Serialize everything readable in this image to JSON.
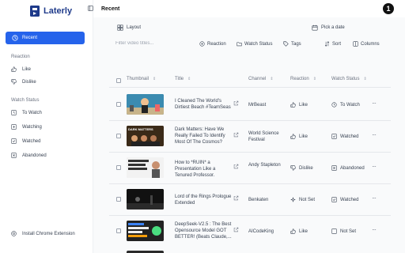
{
  "app": {
    "name": "Laterly"
  },
  "sidebar": {
    "recent_label": "Recent",
    "reaction_heading": "Reaction",
    "reaction_items": [
      {
        "label": "Like",
        "icon": "thumbs-up-icon"
      },
      {
        "label": "Dislike",
        "icon": "thumbs-down-icon"
      }
    ],
    "watch_heading": "Watch Status",
    "watch_items": [
      {
        "label": "To Watch",
        "icon": "clock-icon"
      },
      {
        "label": "Watching",
        "icon": "play-icon"
      },
      {
        "label": "Watched",
        "icon": "check-square-icon"
      },
      {
        "label": "Abandoned",
        "icon": "x-square-icon"
      }
    ],
    "install_label": "Install Chrome Extension"
  },
  "header": {
    "title": "Recent",
    "badge": "1"
  },
  "toolbar": {
    "layout_label": "Layout",
    "date_label": "Pick a date",
    "filter_placeholder": "Filter video titles...",
    "reaction_label": "Reaction",
    "watch_status_label": "Watch Status",
    "tags_label": "Tags",
    "sort_label": "Sort",
    "columns_label": "Columns"
  },
  "table": {
    "headers": {
      "thumbnail": "Thumbnail",
      "title": "Title",
      "channel": "Channel",
      "reaction": "Reaction",
      "watch_status": "Watch Status"
    },
    "rows": [
      {
        "title": "I Cleaned The World's Dirtiest Beach #TeamSeas",
        "channel": "MrBeast",
        "reaction": "Like",
        "status": "To Watch",
        "thumb_bg": "#2a6a8a"
      },
      {
        "title": "Dark Matters: Have We Really Failed To Identify Most Of The Cosmos?",
        "channel": "World Science Festival",
        "reaction": "Like",
        "status": "Watched",
        "thumb_bg": "#4a3320"
      },
      {
        "title": "How to *RUIN* a Presentation Like a Tenured Professor.",
        "channel": "Andy Stapleton",
        "reaction": "Dislike",
        "status": "Abandoned",
        "thumb_bg": "#e5e5e5"
      },
      {
        "title": "Lord of the Rings Prologue Extended",
        "channel": "Benkaten",
        "reaction": "Not Set",
        "status": "Watched",
        "thumb_bg": "#1a1a1a"
      },
      {
        "title": "DeepSeek-V2.5 : The Best Opensource Model GOT BETTER! (Beats Claude,...",
        "channel": "AICodeKing",
        "reaction": "Like",
        "status": "Not Set",
        "thumb_bg": "#2a2a2a"
      }
    ]
  },
  "colors": {
    "accent": "#2563eb",
    "brand": "#1e3a8a"
  }
}
